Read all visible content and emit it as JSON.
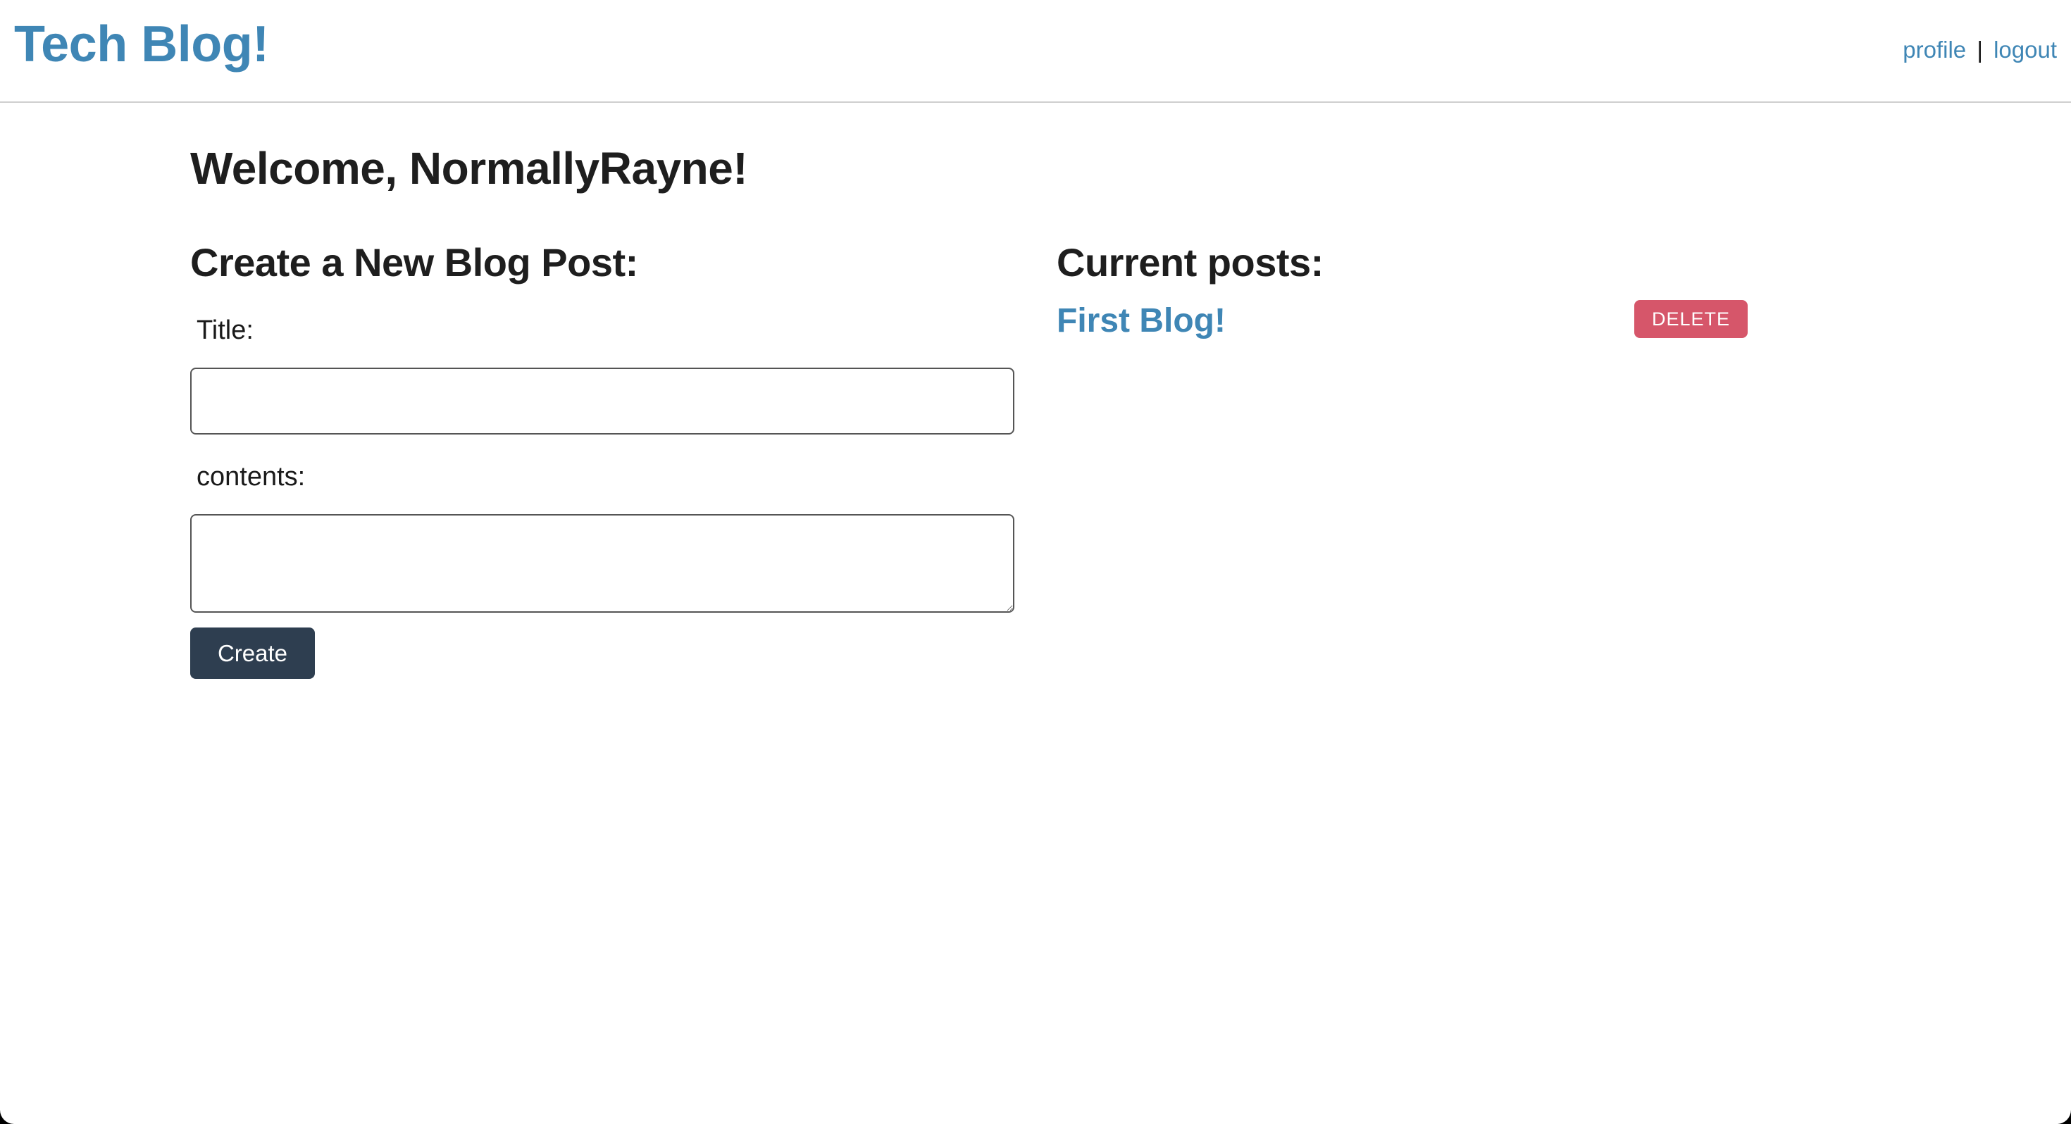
{
  "header": {
    "brand": "Tech Blog!",
    "nav": {
      "profile_label": "profile",
      "separator": "|",
      "logout_label": "logout"
    }
  },
  "main": {
    "welcome": "Welcome, NormallyRayne!",
    "create_form": {
      "heading": "Create a New Blog Post:",
      "title_label": "Title:",
      "title_value": "",
      "contents_label": "contents:",
      "contents_value": "",
      "create_button_label": "Create"
    },
    "posts": {
      "heading": "Current posts:",
      "items": [
        {
          "title": "First Blog!",
          "delete_label": "DELETE"
        }
      ]
    }
  },
  "colors": {
    "accent_link": "#3f86b5",
    "create_button_bg": "#2e3e50",
    "delete_button_bg": "#d6566a",
    "text": "#1e1e1e"
  }
}
